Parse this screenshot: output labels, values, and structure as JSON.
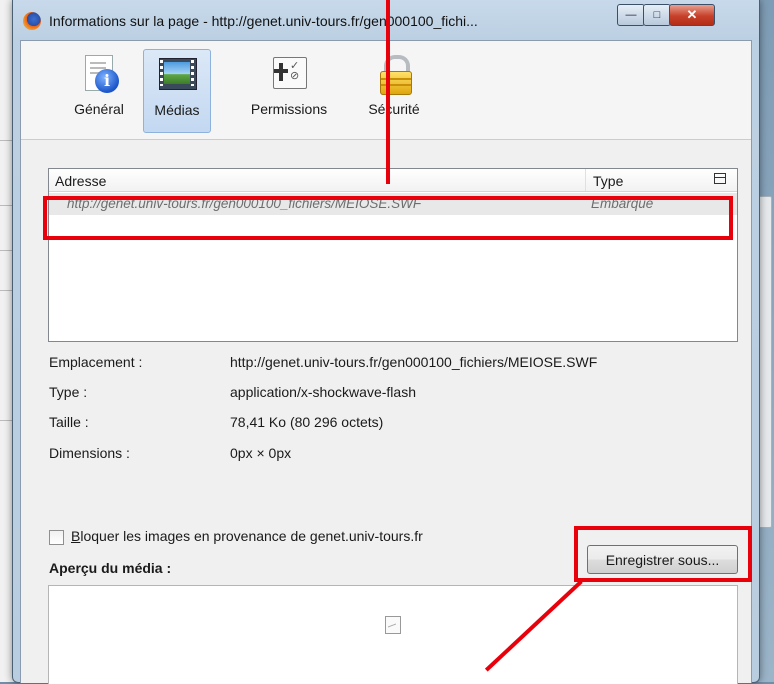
{
  "window": {
    "title": "Informations sur la page - http://genet.univ-tours.fr/gen000100_fichi...",
    "minimize_label": "—",
    "maximize_label": "□",
    "close_label": "✕"
  },
  "toolbar": {
    "tabs": [
      {
        "label": "Général",
        "icon": "info-page-icon"
      },
      {
        "label": "Médias",
        "icon": "media-image-icon",
        "active": true
      },
      {
        "label": "Permissions",
        "icon": "permissions-icon"
      },
      {
        "label": "Sécurité",
        "icon": "padlock-icon"
      }
    ]
  },
  "media_table": {
    "columns": [
      "Adresse",
      "Type"
    ],
    "rows": [
      {
        "address": "http://genet.univ-tours.fr/gen000100_fichiers/MEIOSE.SWF",
        "type": "Embarqué"
      }
    ]
  },
  "properties": [
    {
      "label": "Emplacement :",
      "value": "http://genet.univ-tours.fr/gen000100_fichiers/MEIOSE.SWF"
    },
    {
      "label": "Type :",
      "value": "application/x-shockwave-flash"
    },
    {
      "label": "Taille :",
      "value": "78,41 Ko (80 296 octets)"
    },
    {
      "label": "Dimensions :",
      "value": "0px × 0px"
    }
  ],
  "block_images": {
    "label_first": "B",
    "label_rest": "loquer les images en provenance de genet.univ-tours.fr",
    "checked": false
  },
  "preview": {
    "title": "Aperçu du média :"
  },
  "save_button": {
    "label": "Enregistrer sous..."
  },
  "annotation_color": "#e8000b"
}
